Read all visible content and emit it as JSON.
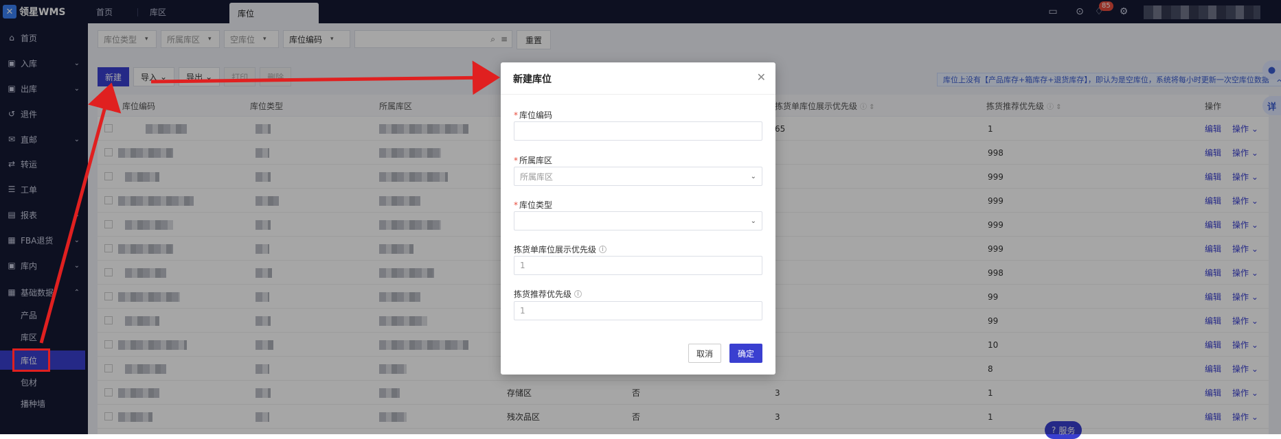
{
  "app": {
    "logo_text": "领星WMS"
  },
  "tabs": [
    {
      "label": "首页"
    },
    {
      "label": "库区"
    },
    {
      "label": "库位"
    }
  ],
  "header": {
    "notification_count": "85"
  },
  "sidebar": {
    "items": [
      {
        "label": "首页",
        "icon": "home-icon"
      },
      {
        "label": "入库",
        "icon": "inbound-icon"
      },
      {
        "label": "出库",
        "icon": "outbound-icon"
      },
      {
        "label": "退件",
        "icon": "return-icon"
      },
      {
        "label": "直邮",
        "icon": "direct-mail-icon"
      },
      {
        "label": "转运",
        "icon": "transfer-icon"
      },
      {
        "label": "工单",
        "icon": "workorder-icon"
      },
      {
        "label": "报表",
        "icon": "report-icon"
      },
      {
        "label": "FBA退货",
        "icon": "fba-return-icon"
      },
      {
        "label": "库内",
        "icon": "warehouse-icon"
      },
      {
        "label": "基础数据",
        "icon": "basic-data-icon"
      }
    ],
    "subitems": [
      {
        "label": "产品"
      },
      {
        "label": "库区"
      },
      {
        "label": "库位"
      },
      {
        "label": "包材"
      },
      {
        "label": "播种墙"
      }
    ]
  },
  "filters": {
    "location_type": "库位类型",
    "zone": "所属库区",
    "empty": "空库位",
    "code": "库位编码",
    "reset": "重置"
  },
  "toolbar": {
    "new": "新建",
    "import": "导入",
    "export": "导出",
    "print": "打印",
    "delete": "删除"
  },
  "notice": "库位上没有【产品库存+箱库存+退货库存】，即认为是空库位，系统将每小时更新一次空库位数据",
  "table": {
    "columns": [
      "库位编码",
      "库位类型",
      "所属库区",
      "拣货单库位展示优先级",
      "拣货推荐优先级",
      "操作"
    ],
    "priority": [
      "1",
      "998",
      "999",
      "999",
      "999",
      "999",
      "998",
      "99",
      "99",
      "10",
      "8",
      "1",
      "1"
    ],
    "zone_visible": [
      "",
      "",
      "",
      "",
      "",
      "",
      "",
      "",
      "",
      "",
      "",
      "存储区",
      "残次品区"
    ],
    "flag_visible": [
      "",
      "",
      "",
      "",
      "",
      "",
      "",
      "",
      "",
      "",
      "",
      "否",
      "否"
    ],
    "display_priority_visible": [
      "65",
      "",
      "",
      "",
      "",
      "",
      "",
      "",
      "",
      "",
      "",
      "3",
      "3"
    ],
    "edit_label": "编辑",
    "ops_label": "操作"
  },
  "modal": {
    "title": "新建库位",
    "fields": {
      "code": {
        "label": "库位编码",
        "value": ""
      },
      "zone": {
        "label": "所属库区",
        "placeholder": "所属库区"
      },
      "type": {
        "label": "库位类型",
        "value": ""
      },
      "display_priority": {
        "label": "拣货单库位展示优先级",
        "value": "1"
      },
      "pick_priority": {
        "label": "拣货推荐优先级",
        "value": "1"
      }
    },
    "cancel": "取消",
    "confirm": "确定"
  },
  "float": {
    "service": "服务",
    "detail": "详"
  },
  "colors": {
    "primary": "#3a3fd0",
    "sidebar_bg": "#141a34",
    "annotation": "#e02020"
  }
}
